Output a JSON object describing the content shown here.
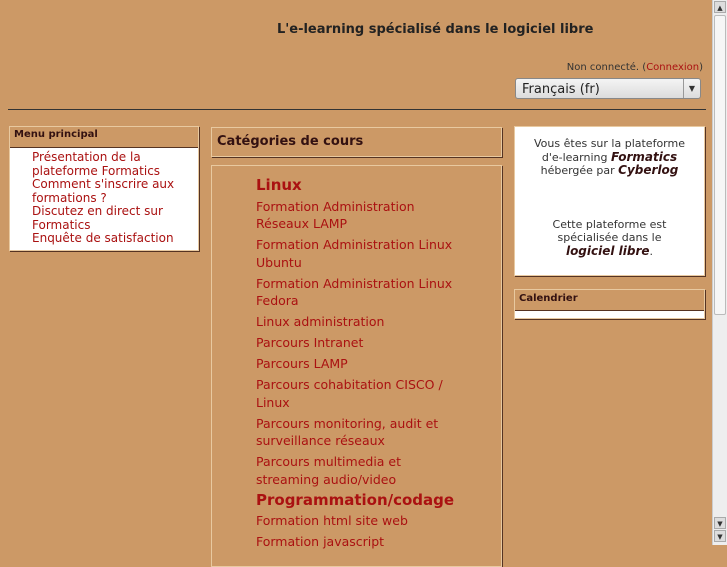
{
  "header": {
    "title": "L'e-learning spécialisé dans le logiciel libre",
    "login_status": "Non connecté.",
    "login_link": "Connexion",
    "language": "Français (fr)"
  },
  "menu": {
    "title": "Menu principal",
    "items": [
      "Présentation de la plateforme Formatics",
      "Comment s'inscrire aux formations ?",
      "Discutez en direct sur Formatics",
      "Enquête de satisfaction"
    ]
  },
  "categories": {
    "title": "Catégories de cours",
    "groups": [
      {
        "name": "Linux",
        "courses": [
          "Formation Administration Réseaux LAMP",
          "Formation Administration Linux Ubuntu",
          "Formation Administration Linux Fedora",
          "Linux administration",
          "Parcours Intranet",
          "Parcours LAMP",
          "Parcours cohabitation CISCO / Linux",
          "Parcours monitoring, audit et surveillance réseaux",
          "Parcours multimedia et streaming audio/video"
        ]
      },
      {
        "name": "Programmation/codage",
        "courses": [
          "Formation html site web",
          "Formation javascript"
        ]
      }
    ]
  },
  "info": {
    "line1": "Vous êtes sur la plateforme d'e-learning",
    "brand": "Formatics",
    "hosted": "hébergée par",
    "host": "Cyberlog",
    "line2": "Cette plateforme est spécialisée dans le",
    "topic": "logiciel libre",
    "end": "."
  },
  "calendar": {
    "title": "Calendrier"
  }
}
